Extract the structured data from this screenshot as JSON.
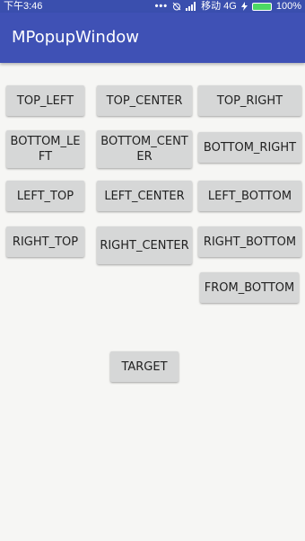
{
  "status_bar": {
    "time": "下午3:46",
    "dots": "•••",
    "alarm_icon": "alarm-off-icon",
    "signal_icon": "signal-icon",
    "carrier": "移动 4G",
    "bolt_icon": "bolt-icon",
    "battery_percent": "100%"
  },
  "app_bar": {
    "title": "MPopupWindow"
  },
  "buttons": {
    "top_left": "TOP_LEFT",
    "top_center": "TOP_CENTER",
    "top_right": "TOP_RIGHT",
    "bottom_left": "BOTTOM_LEFT",
    "bottom_center": "BOTTOM_CENTER",
    "bottom_right": "BOTTOM_RIGHT",
    "left_top": "LEFT_TOP",
    "left_center": "LEFT_CENTER",
    "left_bottom": "LEFT_BOTTOM",
    "right_top": "RIGHT_TOP",
    "right_center": "RIGHT_CENTER",
    "right_bottom": "RIGHT_BOTTOM",
    "from_bottom": "FROM_BOTTOM",
    "target": "TARGET"
  },
  "colors": {
    "primary": "#3f51b5",
    "status_bar": "#3a4fae",
    "background": "#f6f6f4",
    "button": "#d6d7d7"
  }
}
